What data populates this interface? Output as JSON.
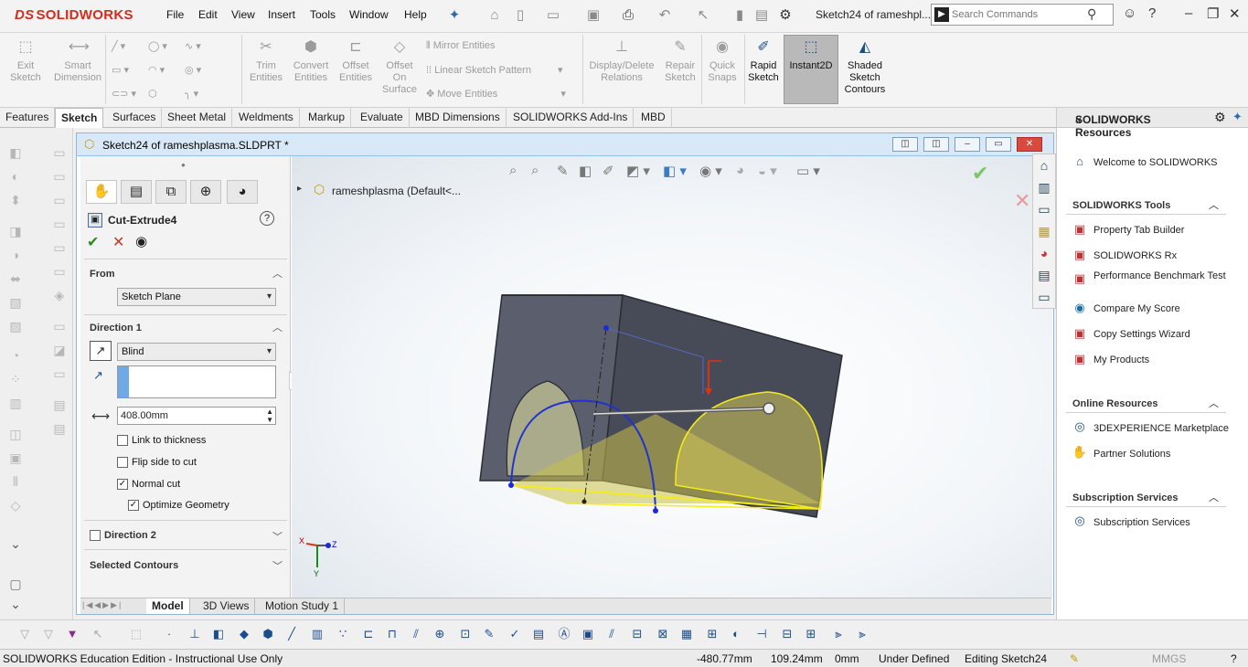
{
  "app": {
    "logo": "SOLIDWORKS",
    "logo_prefix": "DS"
  },
  "menu": [
    "File",
    "Edit",
    "View",
    "Insert",
    "Tools",
    "Window",
    "Help"
  ],
  "document_title": "Sketch24 of rameshpl...",
  "search": {
    "placeholder": "Search Commands"
  },
  "sketch_tools": {
    "exit_sketch": "Exit Sketch",
    "smart_dimension": "Smart Dimension",
    "trim_entities": "Trim Entities",
    "convert_entities": "Convert Entities",
    "offset_entities": "Offset Entities",
    "offset_on_surface": "Offset On Surface",
    "mirror_entities": "Mirror Entities",
    "linear_sketch_pattern": "Linear Sketch Pattern",
    "move_entities": "Move Entities",
    "display_delete_relations": "Display/Delete Relations",
    "repair_sketch": "Repair Sketch",
    "quick_snaps": "Quick Snaps",
    "rapid_sketch": "Rapid Sketch",
    "instant2d": "Instant2D",
    "shaded_sketch_contours": "Shaded Sketch Contours"
  },
  "cm_tabs": [
    "Features",
    "Sketch",
    "Surfaces",
    "Sheet Metal",
    "Weldments",
    "Markup",
    "Evaluate",
    "MBD Dimensions",
    "SOLIDWORKS Add-Ins",
    "MBD"
  ],
  "doc_window": {
    "title": "Sketch24 of rameshplasma.SLDPRT *"
  },
  "property_manager": {
    "feature_name": "Cut-Extrude4",
    "from": {
      "label": "From",
      "value": "Sketch Plane"
    },
    "direction1": {
      "label": "Direction 1",
      "end_condition": "Blind",
      "depth": "408.00mm",
      "link_to_thickness": "Link to thickness",
      "flip_side_to_cut": "Flip side to cut",
      "normal_cut": "Normal cut",
      "optimize_geometry": "Optimize Geometry"
    },
    "direction2": {
      "label": "Direction 2"
    },
    "selected_contours": {
      "label": "Selected Contours"
    }
  },
  "feature_tree": {
    "root": "rameshplasma  (Default<..."
  },
  "bottom_tabs": [
    "Model",
    "3D Views",
    "Motion Study 1"
  ],
  "task_pane": {
    "header": "SOLIDWORKS Resources",
    "welcome": "Welcome to SOLIDWORKS",
    "tools_header": "SOLIDWORKS Tools",
    "tools": [
      "Property Tab Builder",
      "SOLIDWORKS Rx",
      "Performance Benchmark Test",
      "Compare My Score",
      "Copy Settings Wizard",
      "My Products"
    ],
    "online_header": "Online Resources",
    "online": [
      "3DEXPERIENCE Marketplace",
      "Partner Solutions"
    ],
    "subscription_header": "Subscription Services",
    "subscription": [
      "Subscription Services"
    ]
  },
  "status_bar": {
    "edition": "SOLIDWORKS Education Edition - Instructional Use Only",
    "x": "-480.77mm",
    "y": "109.24mm",
    "z": "0mm",
    "state": "Under Defined",
    "editing": "Editing Sketch24",
    "units": "MMGS"
  },
  "triad": {
    "x": "X",
    "y": "Y",
    "z": "Z"
  },
  "colors": {
    "brand": "#d52b1e",
    "accent": "#1b4d8b",
    "part": "#4e515e",
    "cut_preview": "#c9c04a"
  }
}
